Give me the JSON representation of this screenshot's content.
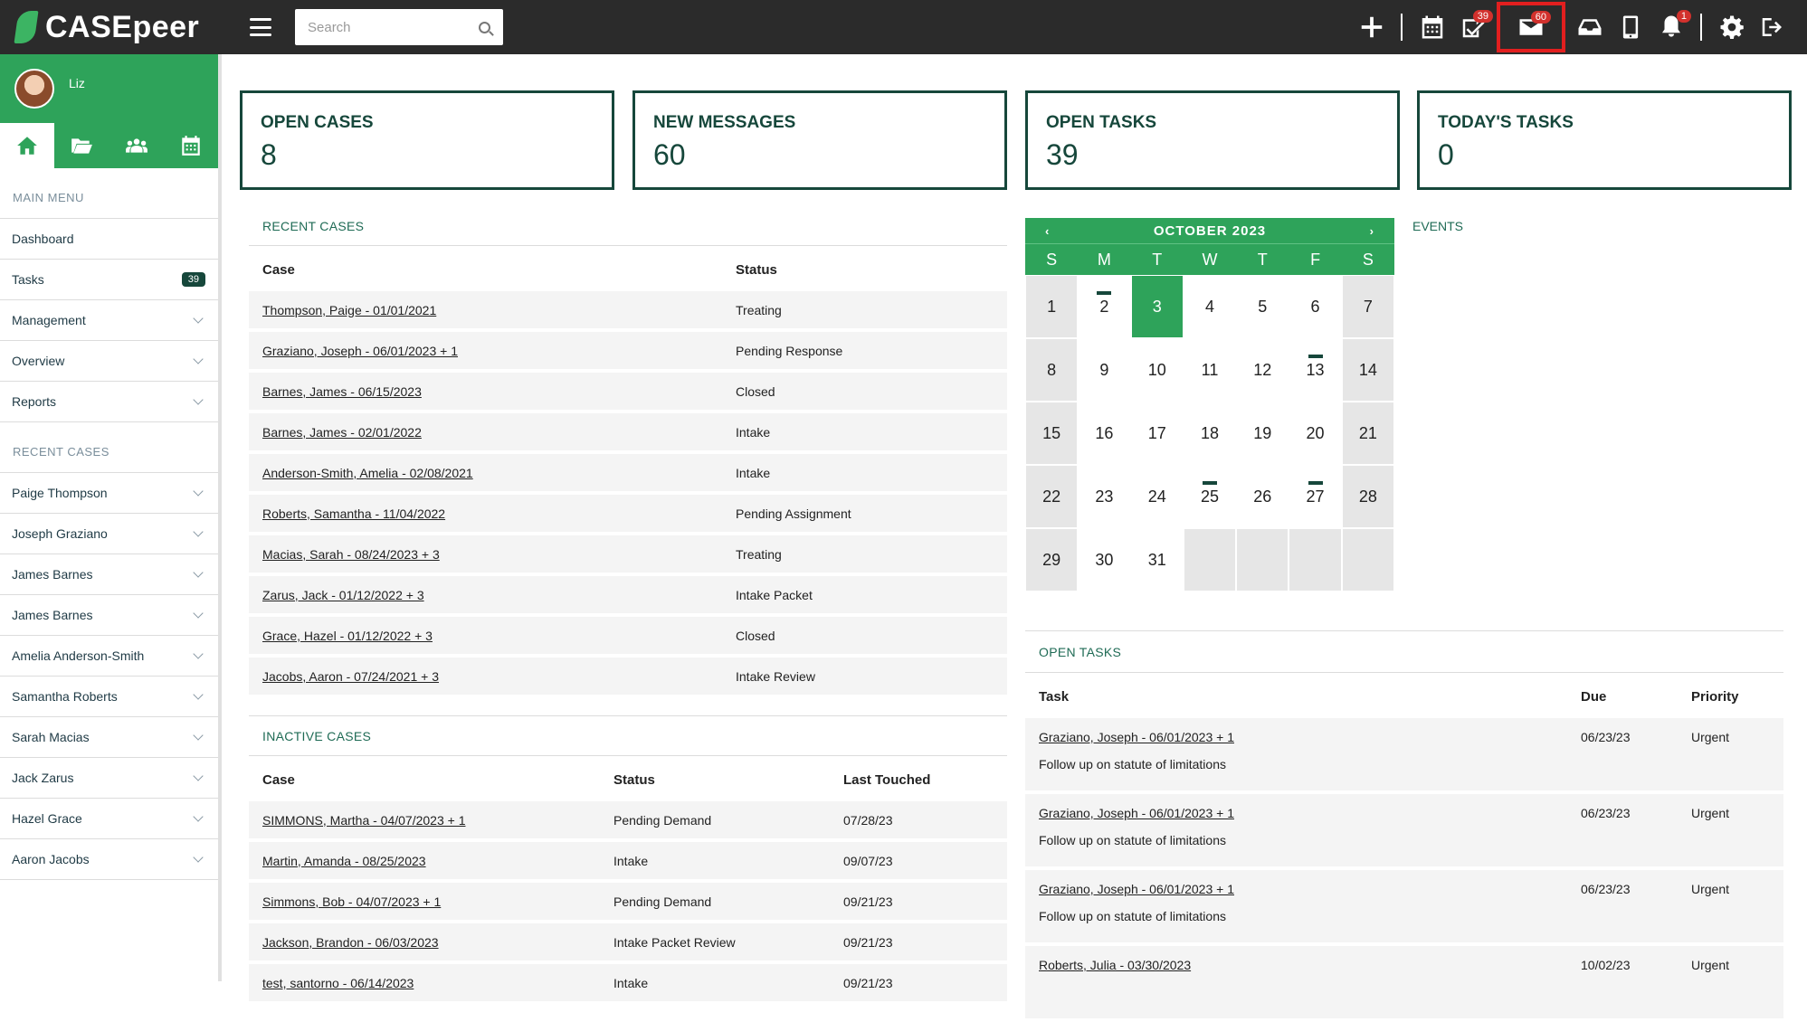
{
  "app": {
    "logo_text": "CASEpeer"
  },
  "search": {
    "placeholder": "Search"
  },
  "top_icons": [
    {
      "name": "add-icon"
    },
    {
      "name": "calendar-icon"
    },
    {
      "name": "tasks-check-icon",
      "badge": "39"
    },
    {
      "name": "messages-envelope-icon",
      "badge": "60"
    },
    {
      "name": "inbox-icon"
    },
    {
      "name": "mobile-icon"
    },
    {
      "name": "notifications-bell-icon",
      "badge": "1"
    },
    {
      "name": "settings-gear-icon"
    },
    {
      "name": "logout-icon"
    }
  ],
  "user": {
    "name": "Liz"
  },
  "sidebar": {
    "main_menu_heading": "MAIN MENU",
    "main_menu": [
      {
        "label": "Dashboard"
      },
      {
        "label": "Tasks",
        "count": "39"
      },
      {
        "label": "Management"
      },
      {
        "label": "Overview"
      },
      {
        "label": "Reports"
      }
    ],
    "recent_heading": "RECENT CASES",
    "recent": [
      "Paige Thompson",
      "Joseph Graziano",
      "James Barnes",
      "James Barnes",
      "Amelia Anderson-Smith",
      "Samantha Roberts",
      "Sarah Macias",
      "Jack Zarus",
      "Hazel Grace",
      "Aaron Jacobs"
    ]
  },
  "stats": [
    {
      "label": "OPEN CASES",
      "value": "8"
    },
    {
      "label": "NEW MESSAGES",
      "value": "60"
    },
    {
      "label": "OPEN TASKS",
      "value": "39"
    },
    {
      "label": "TODAY'S TASKS",
      "value": "0"
    }
  ],
  "recent_cases": {
    "title": "RECENT CASES",
    "headers": [
      "Case",
      "Status"
    ],
    "rows": [
      [
        "Thompson, Paige - 01/01/2021",
        "Treating"
      ],
      [
        "Graziano, Joseph - 06/01/2023 + 1",
        "Pending Response"
      ],
      [
        "Barnes, James - 06/15/2023",
        "Closed"
      ],
      [
        "Barnes, James - 02/01/2022",
        "Intake"
      ],
      [
        "Anderson-Smith, Amelia - 02/08/2021",
        "Intake"
      ],
      [
        "Roberts, Samantha - 11/04/2022",
        "Pending Assignment"
      ],
      [
        "Macias, Sarah - 08/24/2023 + 3",
        "Treating"
      ],
      [
        "Zarus, Jack - 01/12/2022 + 3",
        "Intake Packet"
      ],
      [
        "Grace, Hazel - 01/12/2022 + 3",
        "Closed"
      ],
      [
        "Jacobs, Aaron - 07/24/2021 + 3",
        "Intake Review"
      ]
    ]
  },
  "inactive_cases": {
    "title": "INACTIVE CASES",
    "headers": [
      "Case",
      "Status",
      "Last Touched"
    ],
    "rows": [
      [
        "SIMMONS, Martha - 04/07/2023 + 1",
        "Pending Demand",
        "07/28/23"
      ],
      [
        "Martin, Amanda - 08/25/2023",
        "Intake",
        "09/07/23"
      ],
      [
        "Simmons, Bob - 04/07/2023 + 1",
        "Pending Demand",
        "09/21/23"
      ],
      [
        "Jackson, Brandon - 06/03/2023",
        "Intake Packet Review",
        "09/21/23"
      ],
      [
        "test, santorno - 06/14/2023",
        "Intake",
        "09/21/23"
      ]
    ]
  },
  "calendar": {
    "month_label": "OCTOBER 2023",
    "prev": "‹",
    "next": "›",
    "dow": [
      "S",
      "M",
      "T",
      "W",
      "T",
      "F",
      "S"
    ],
    "days": [
      "1",
      "2",
      "3",
      "4",
      "5",
      "6",
      "7",
      "8",
      "9",
      "10",
      "11",
      "12",
      "13",
      "14",
      "15",
      "16",
      "17",
      "18",
      "19",
      "20",
      "21",
      "22",
      "23",
      "24",
      "25",
      "26",
      "27",
      "28",
      "29",
      "30",
      "31",
      "",
      "",
      "",
      ""
    ],
    "today": "3",
    "event_days": [
      "2",
      "13",
      "25",
      "27"
    ]
  },
  "events": {
    "title": "EVENTS"
  },
  "open_tasks": {
    "title": "OPEN TASKS",
    "headers": [
      "Task",
      "Due",
      "Priority"
    ],
    "rows": [
      {
        "case": "Graziano, Joseph - 06/01/2023 + 1",
        "desc": "Follow up on statute of limitations",
        "due": "06/23/23",
        "priority": "Urgent"
      },
      {
        "case": "Graziano, Joseph - 06/01/2023 + 1",
        "desc": "Follow up on statute of limitations",
        "due": "06/23/23",
        "priority": "Urgent"
      },
      {
        "case": "Graziano, Joseph - 06/01/2023 + 1",
        "desc": "Follow up on statute of limitations",
        "due": "06/23/23",
        "priority": "Urgent"
      },
      {
        "case": "Roberts, Julia - 03/30/2023",
        "desc": "",
        "due": "10/02/23",
        "priority": "Urgent"
      }
    ]
  },
  "colors": {
    "brand_green": "#2ea35a",
    "dark_green": "#16473b",
    "topbar": "#2b2b2b",
    "urgent": "#c0392b",
    "highlight": "#e21f1f"
  }
}
